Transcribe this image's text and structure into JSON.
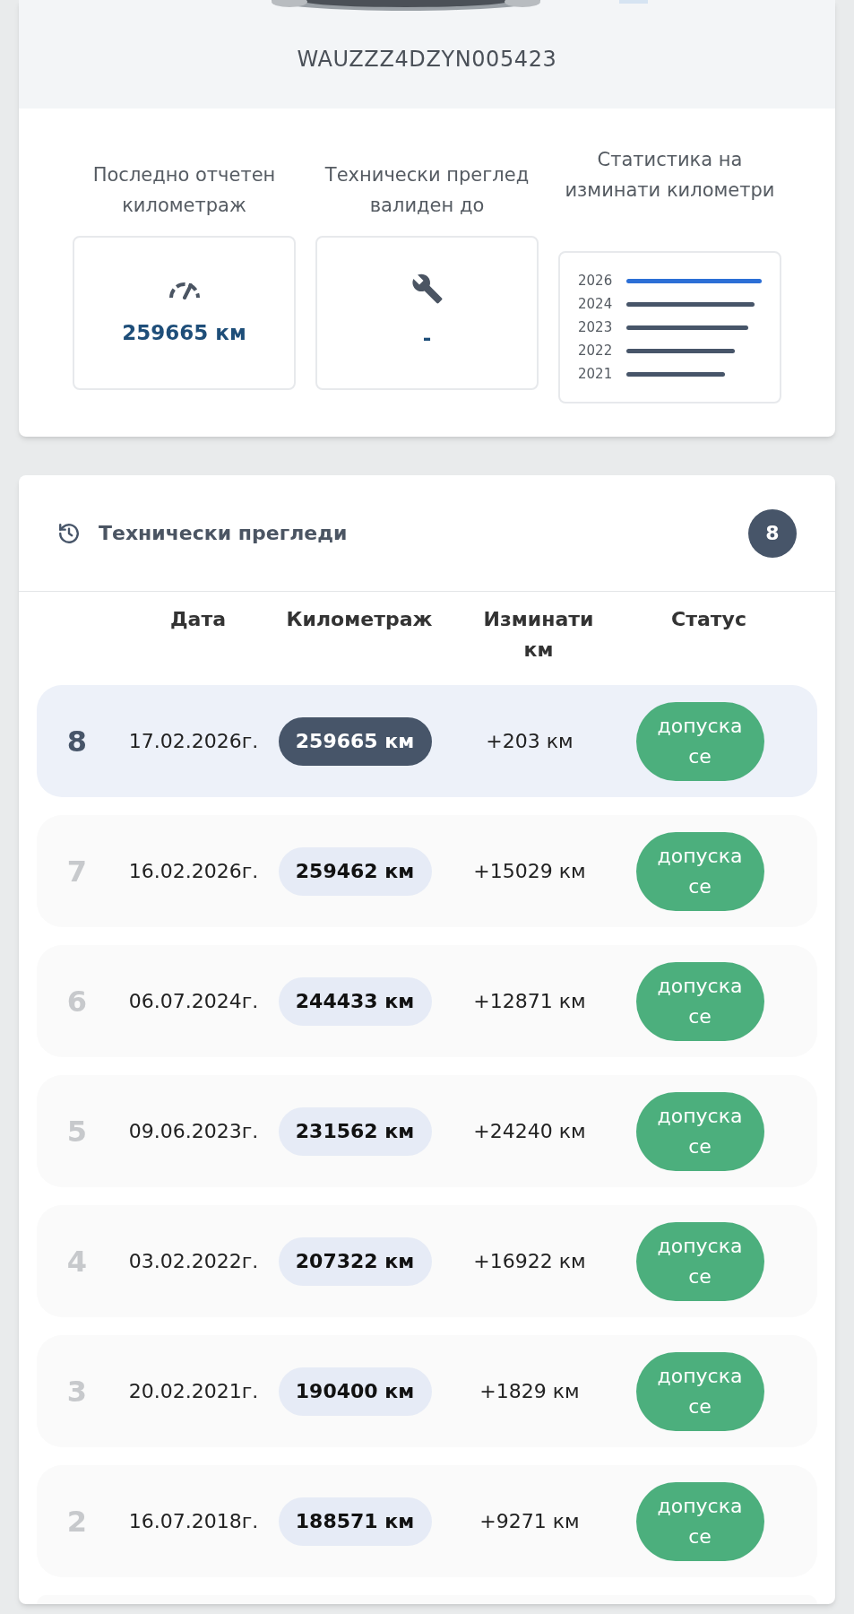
{
  "vehicle": {
    "vin": "WAUZZZ4DZYN005423"
  },
  "stats": [
    {
      "kind": "mileage",
      "label": "Последно отчетен километраж",
      "value": "259665 км"
    },
    {
      "kind": "inspection",
      "label": "Технически преглед валиден до",
      "value": "-"
    },
    {
      "kind": "chart",
      "label": "Статистика на изминати километри",
      "bars": [
        {
          "year": "2026",
          "color": "#2c6fd6"
        },
        {
          "year": "2024",
          "color": "#475569"
        },
        {
          "year": "2023",
          "color": "#475569"
        },
        {
          "year": "2022",
          "color": "#475569"
        },
        {
          "year": "2021",
          "color": "#475569"
        }
      ]
    }
  ],
  "inspections": {
    "title": "Технически прегледи",
    "count": "8",
    "columns": [
      "Дата",
      "Километраж",
      "Изминати км",
      "Статус"
    ],
    "rows": [
      {
        "index": "8",
        "date": "17.02.2026г.",
        "mileage": "259665 км",
        "diff": "+203 км",
        "status": "допуска се",
        "selected": true
      },
      {
        "index": "7",
        "date": "16.02.2026г.",
        "mileage": "259462 км",
        "diff": "+15029 км",
        "status": "допуска се",
        "selected": false
      },
      {
        "index": "6",
        "date": "06.07.2024г.",
        "mileage": "244433 км",
        "diff": "+12871 км",
        "status": "допуска се",
        "selected": false
      },
      {
        "index": "5",
        "date": "09.06.2023г.",
        "mileage": "231562 км",
        "diff": "+24240 км",
        "status": "допуска се",
        "selected": false
      },
      {
        "index": "4",
        "date": "03.02.2022г.",
        "mileage": "207322 км",
        "diff": "+16922 км",
        "status": "допуска се",
        "selected": false
      },
      {
        "index": "3",
        "date": "20.02.2021г.",
        "mileage": "190400 км",
        "diff": "+1829 км",
        "status": "допуска се",
        "selected": false
      },
      {
        "index": "2",
        "date": "16.07.2018г.",
        "mileage": "188571 км",
        "diff": "+9271 км",
        "status": "допуска се",
        "selected": false
      }
    ]
  }
}
